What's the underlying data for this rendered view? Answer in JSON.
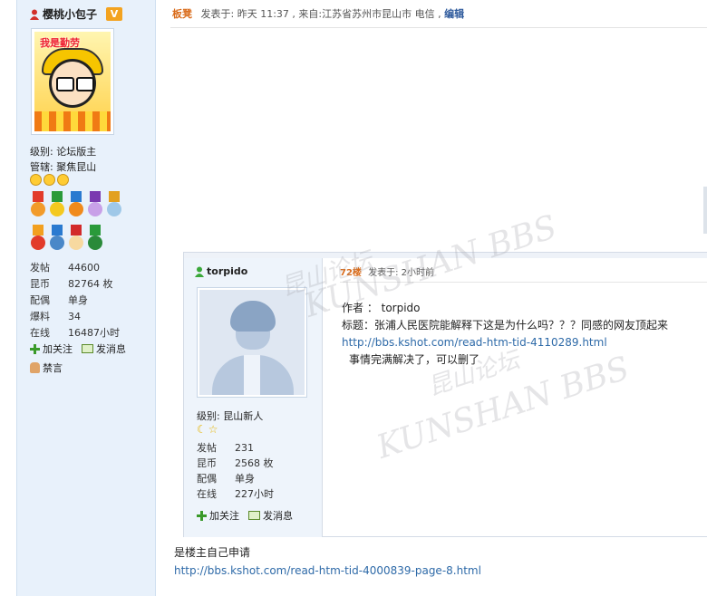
{
  "poster": {
    "username": "樱桃小包子",
    "badge": "V",
    "avatar_text": "我是勤劳小蜜蜂",
    "level": "级别: 论坛版主",
    "manage": "管辖: 聚焦昆山",
    "stats": [
      {
        "label": "发帖",
        "value": "44600"
      },
      {
        "label": "昆币",
        "value": "82764 枚"
      },
      {
        "label": "配偶",
        "value": "单身"
      },
      {
        "label": "爆料",
        "value": "34"
      },
      {
        "label": "在线",
        "value": "16487小时"
      }
    ],
    "follow_label": "加关注",
    "message_label": "发消息",
    "ban_label": "禁言"
  },
  "post_header": {
    "floor": "板凳",
    "meta": "发表于: 昨天 11:37 , 来自:江苏省苏州市昆山市 电信 ,",
    "edit_label": "编辑"
  },
  "quote": {
    "username": "torpido",
    "level": "级别: 昆山新人",
    "stats": [
      {
        "label": "发帖",
        "value": "231"
      },
      {
        "label": "昆币",
        "value": "2568 枚"
      },
      {
        "label": "配偶",
        "value": "单身"
      },
      {
        "label": "在线",
        "value": "227小时"
      }
    ],
    "follow_label": "加关注",
    "message_label": "发消息",
    "floor": "72楼",
    "meta": "发表于: 2小时前",
    "author_line": "作者 ： torpido",
    "title_line": "标题：张浦人民医院能解释下这是为什么吗？？？同感的网友顶起来",
    "link": "http://bbs.kshot.com/read-htm-tid-4110289.html",
    "body_text": "事情完满解决了，可以删了"
  },
  "reply": {
    "text": "是楼主自己申请",
    "link": "http://bbs.kshot.com/read-htm-tid-4000839-page-8.html"
  },
  "watermark": {
    "line1": "昆山论坛",
    "line2": "KUNSHAN BBS"
  },
  "colors": {
    "floor": "#d96b1a",
    "link": "#2e6aa8",
    "sidebar_bg": "#e8f1fb",
    "badge": "#f3a320"
  }
}
